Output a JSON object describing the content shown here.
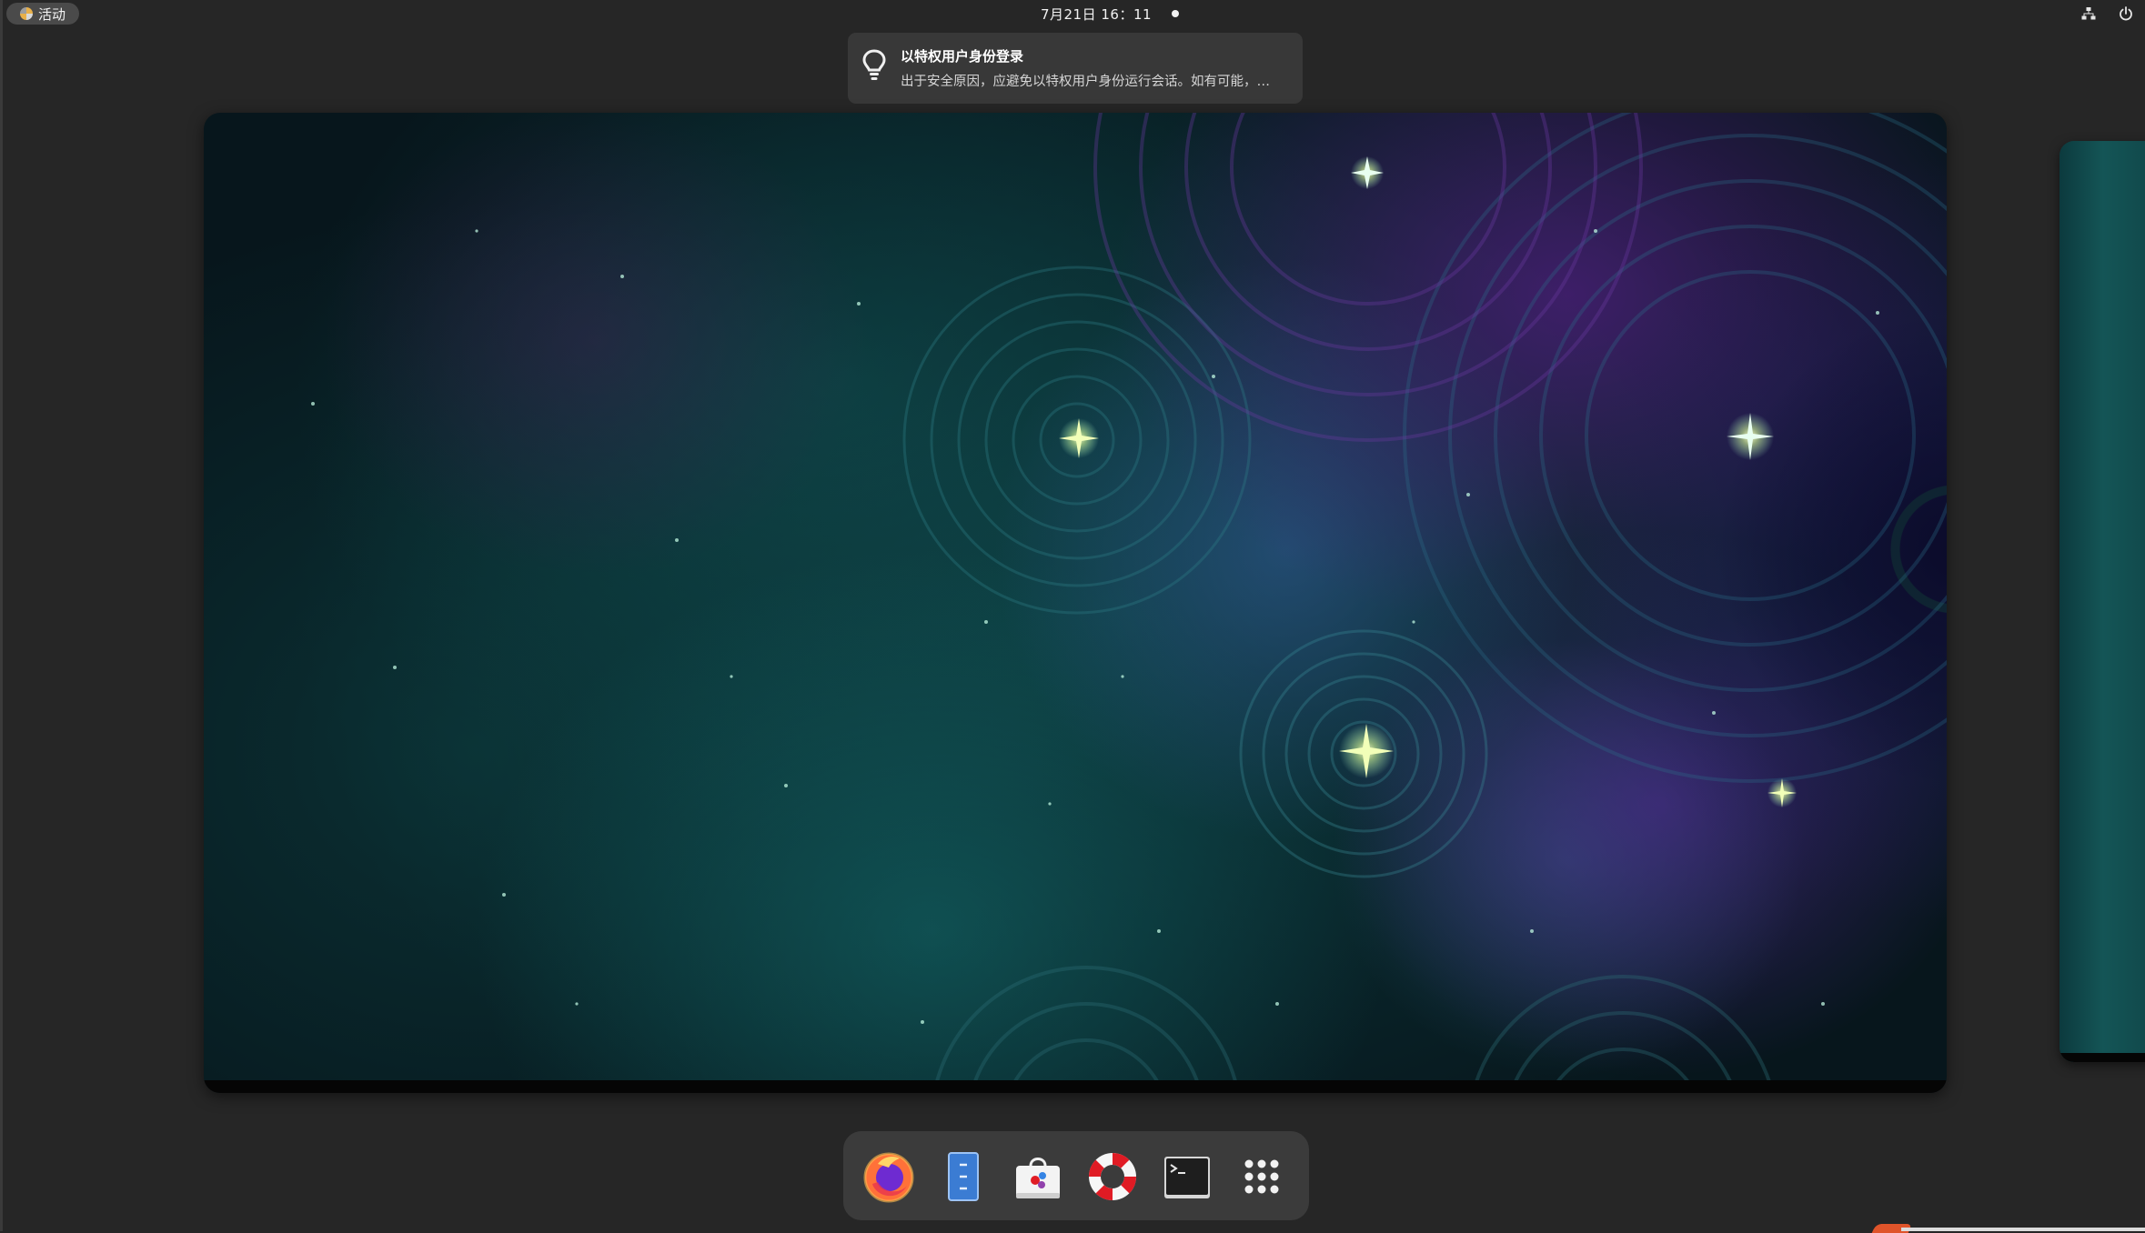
{
  "topbar": {
    "activities_label": "活动",
    "clock": "7月21日 16：11"
  },
  "notification": {
    "icon": "lightbulb-icon",
    "title": "以特权用户身份登录",
    "body": "出于安全原因，应避免以特权用户身份运行会话。如有可能，…"
  },
  "tray": {
    "network_icon": "network-wired-icon",
    "power_icon": "power-icon"
  },
  "dock": {
    "items": [
      {
        "name": "Firefox",
        "icon": "firefox-icon"
      },
      {
        "name": "Files",
        "icon": "file-manager-icon"
      },
      {
        "name": "Software",
        "icon": "software-store-icon"
      },
      {
        "name": "Help",
        "icon": "help-lifebuoy-icon"
      },
      {
        "name": "Terminal",
        "icon": "terminal-icon"
      },
      {
        "name": "Show Apps",
        "icon": "app-grid-icon"
      }
    ]
  },
  "colors": {
    "panel_bg": "#262626",
    "notification_bg": "#383838",
    "dock_bg": "#3b3b3b",
    "accent_orange": "#e0542a"
  }
}
